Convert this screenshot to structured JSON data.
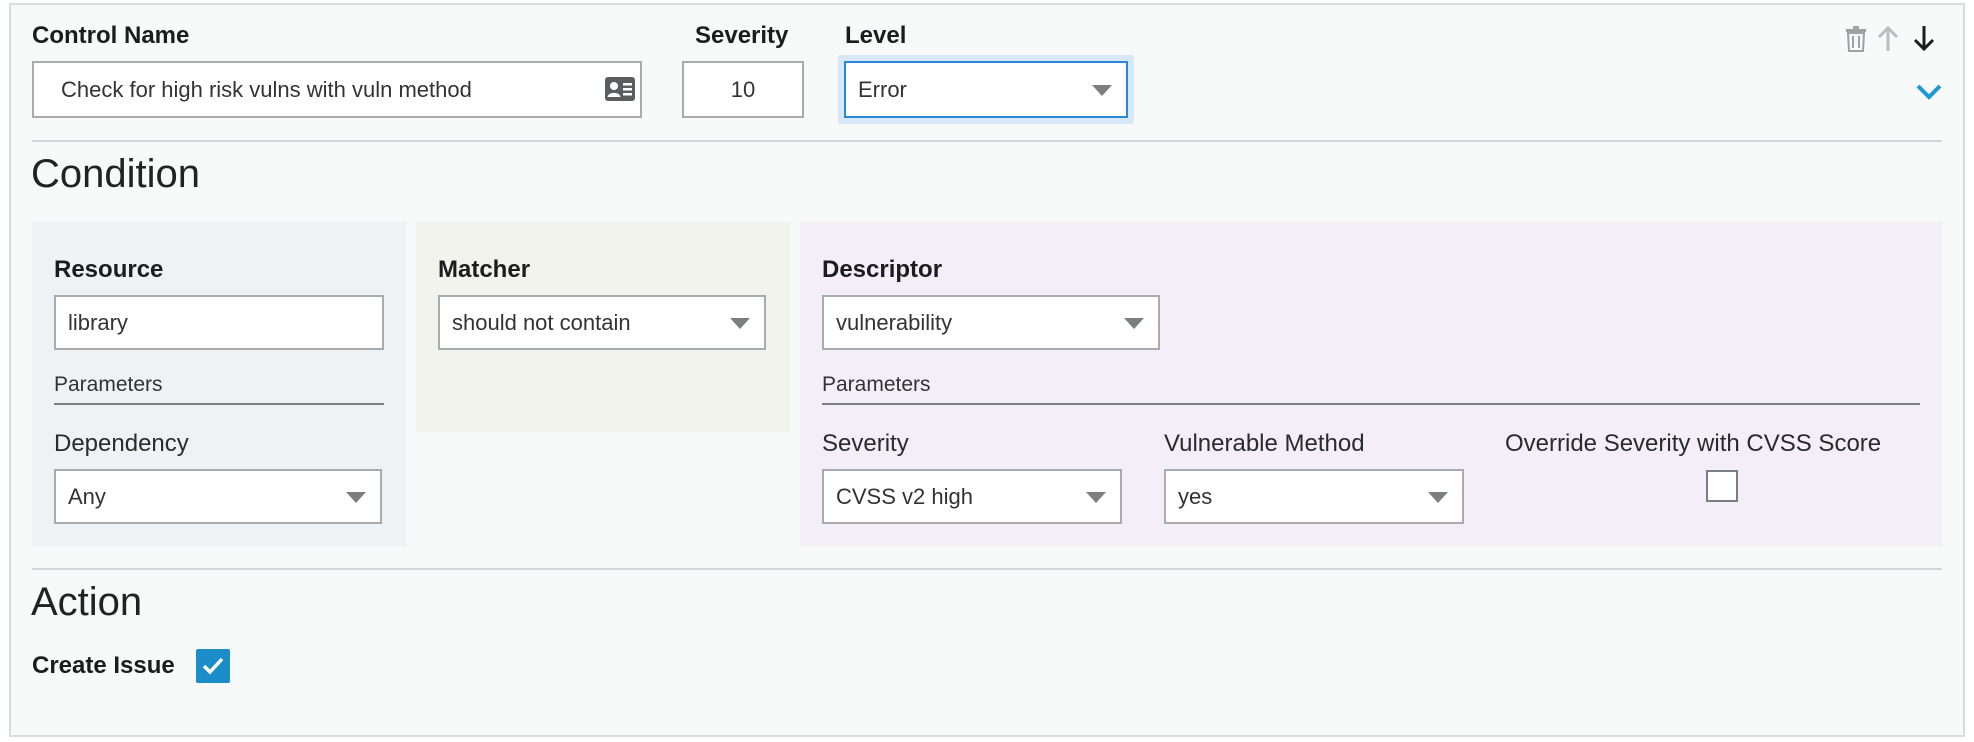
{
  "header": {
    "control_name_label": "Control Name",
    "control_name_value": "Check for high risk vulns with vuln method",
    "severity_label": "Severity",
    "severity_value": "10",
    "level_label": "Level",
    "level_value": "Error"
  },
  "condition": {
    "title": "Condition",
    "resource": {
      "label": "Resource",
      "value": "library",
      "parameters_label": "Parameters",
      "dependency_label": "Dependency",
      "dependency_value": "Any"
    },
    "matcher": {
      "label": "Matcher",
      "value": "should not contain"
    },
    "descriptor": {
      "label": "Descriptor",
      "value": "vulnerability",
      "parameters_label": "Parameters",
      "severity_label": "Severity",
      "severity_value": "CVSS v2 high",
      "vulnerable_method_label": "Vulnerable Method",
      "vulnerable_method_value": "yes",
      "override_label": "Override Severity with CVSS Score",
      "override_checked": false
    }
  },
  "action": {
    "title": "Action",
    "create_issue_label": "Create Issue",
    "create_issue_checked": true
  },
  "colors": {
    "resource_panel": "#eef2f5",
    "matcher_panel": "#f3f3ee",
    "descriptor_panel": "#f3eef8",
    "accent": "#1b8ec9",
    "focus": "#2a88d8"
  }
}
